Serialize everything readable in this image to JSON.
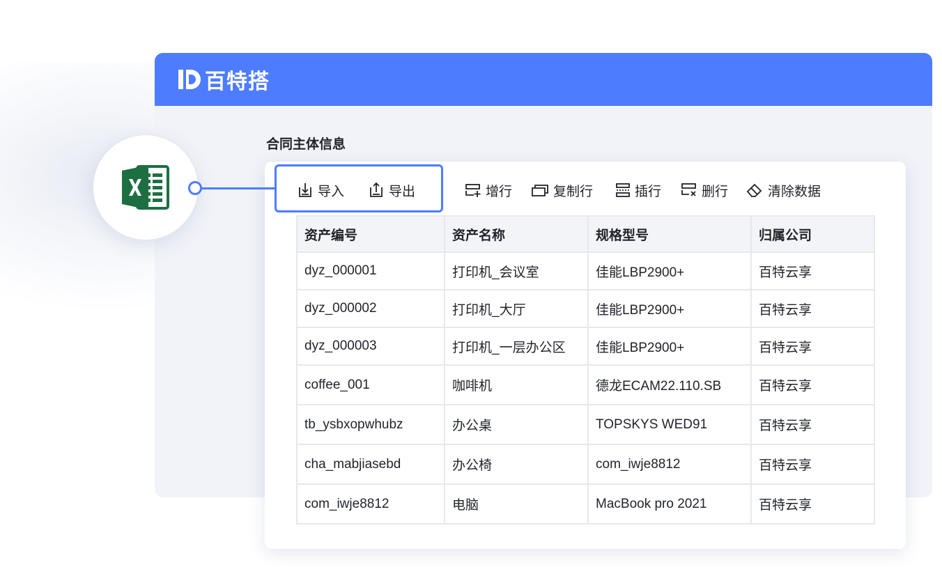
{
  "app": {
    "brand_name": "百特搭"
  },
  "section": {
    "title": "合同主体信息"
  },
  "toolbar": {
    "import_label": "导入",
    "export_label": "导出",
    "add_row_label": "增行",
    "copy_row_label": "复制行",
    "insert_row_label": "插行",
    "delete_row_label": "删行",
    "clear_data_label": "清除数据"
  },
  "icons": {
    "excel": "excel-icon",
    "import": "import-icon",
    "export": "export-icon",
    "add_row": "add-row-icon",
    "copy_row": "copy-row-icon",
    "insert_row": "insert-row-icon",
    "delete_row": "delete-row-icon",
    "clear_data": "eraser-icon"
  },
  "colors": {
    "accent": "#4d7cfe",
    "excel_green": "#1d6f42"
  },
  "table": {
    "columns": [
      "资产编号",
      "资产名称",
      "规格型号",
      "归属公司"
    ],
    "rows": [
      [
        "dyz_000001",
        "打印机_会议室",
        "佳能LBP2900+",
        "百特云享"
      ],
      [
        "dyz_000002",
        "打印机_大厅",
        "佳能LBP2900+",
        "百特云享"
      ],
      [
        "dyz_000003",
        "打印机_一层办公区",
        "佳能LBP2900+",
        "百特云享"
      ],
      [
        "coffee_001",
        "咖啡机",
        "德龙ECAM22.110.SB",
        "百特云享"
      ],
      [
        "tb_ysbxopwhubz",
        "办公桌",
        "TOPSKYS WED91",
        "百特云享"
      ],
      [
        "cha_mabjiasebd",
        "办公椅",
        "com_iwje8812",
        "百特云享"
      ],
      [
        "com_iwje8812",
        "电脑",
        "MacBook pro 2021",
        "百特云享"
      ]
    ]
  }
}
